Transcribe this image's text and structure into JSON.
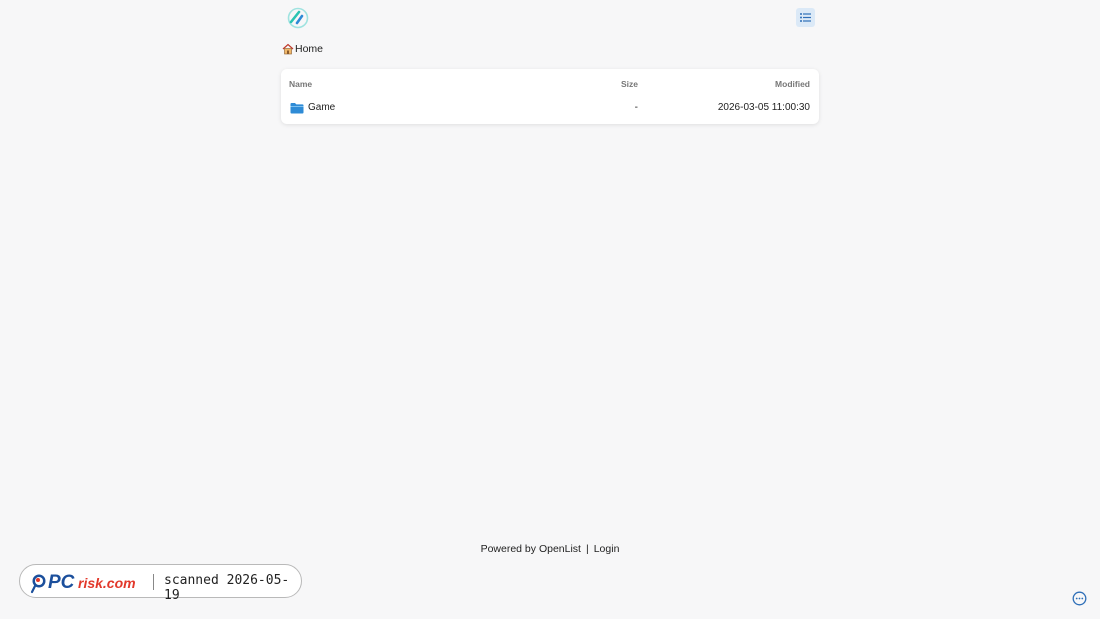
{
  "header": {
    "logo_icon": "openlist-logo-icon",
    "view_toggle_icon": "list-view-icon"
  },
  "breadcrumb": {
    "home_icon": "home-icon",
    "home_label": "Home"
  },
  "file_list": {
    "columns": {
      "name": "Name",
      "size": "Size",
      "modified": "Modified"
    },
    "rows": [
      {
        "icon": "folder-icon",
        "name": "Game",
        "size": "-",
        "modified": "2026-03-05 11:00:30"
      }
    ]
  },
  "footer": {
    "powered_by": "Powered by OpenList",
    "separator": "|",
    "login": "Login"
  },
  "watermark": {
    "brand": "PCrisk.com",
    "scan_text": "scanned 2026-05-19"
  },
  "chat": {
    "icon": "chat-bubble-icon"
  },
  "colors": {
    "background": "#f7f7f8",
    "accent": "#2e8bd6",
    "toggle_bg": "#dbe9f7",
    "watermark_red": "#e2382a",
    "watermark_blue": "#1b4f9c"
  }
}
